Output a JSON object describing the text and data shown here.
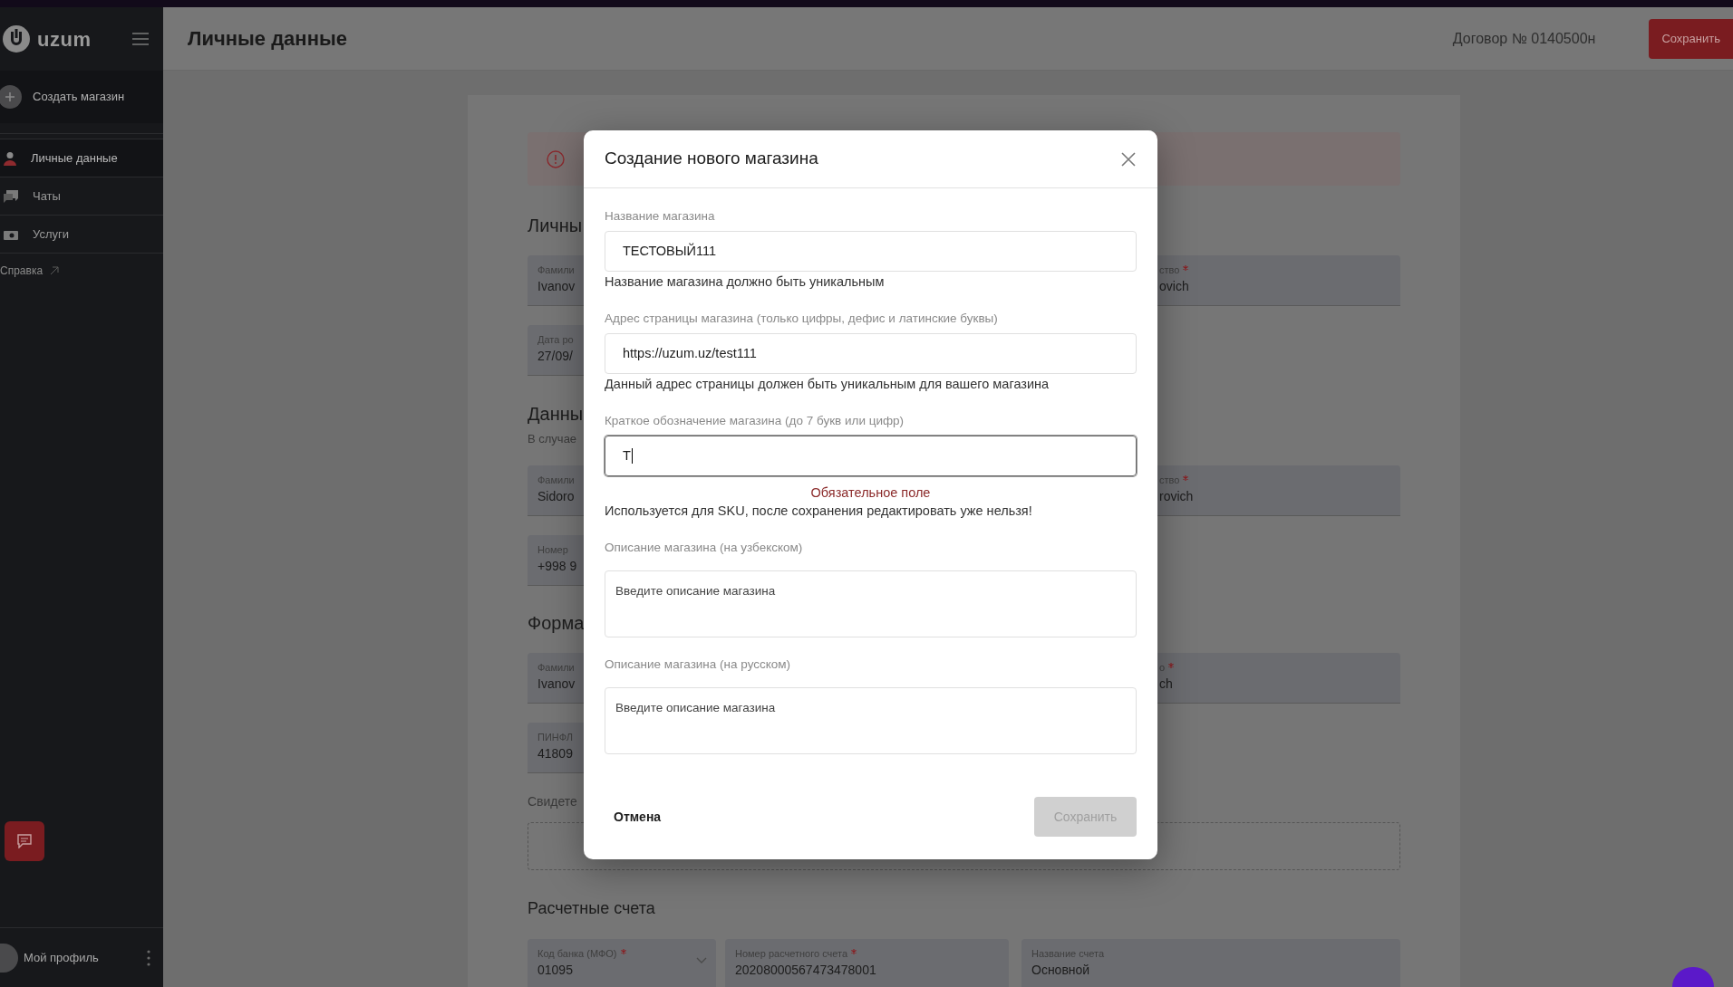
{
  "sidebar": {
    "logo": "uzum",
    "create_button": "Создать магазин",
    "items": [
      {
        "label": "Личные данные",
        "selected": true
      },
      {
        "label": "Чаты",
        "selected": false
      },
      {
        "label": "Услуги",
        "selected": false
      }
    ],
    "help_link": "Справка",
    "profile": "Мой профиль"
  },
  "header": {
    "title": "Личные данные",
    "contract": "Договор № 0140500н",
    "save_button": "Сохранить"
  },
  "page": {
    "sections": [
      {
        "title": "Личны",
        "rows": [
          {
            "left": {
              "label": "Фамили",
              "value": "Ivanov"
            },
            "right": {
              "label": "ство",
              "required": true,
              "value": "ovich"
            }
          },
          {
            "left": {
              "label": "Дата ро",
              "value": "27/09/"
            }
          }
        ]
      },
      {
        "title": "Данны",
        "subtitle": "В случае",
        "rows": [
          {
            "left": {
              "label": "Фамили",
              "value": "Sidoro"
            },
            "right": {
              "label": "ство",
              "required": true,
              "value": "rovich"
            }
          },
          {
            "left": {
              "label": "Номер",
              "value": "+998 9"
            }
          }
        ]
      },
      {
        "title": "Форма",
        "rows": [
          {
            "left": {
              "label": "Фамили",
              "value": "Ivanov"
            },
            "right": {
              "label": "о",
              "required": true,
              "value": "ch"
            }
          },
          {
            "left": {
              "label": "ПИНФЛ",
              "value": "41809"
            }
          }
        ],
        "upload_label": "Свидете"
      }
    ],
    "accounts": {
      "title": "Расчетные счета",
      "fields": [
        {
          "kind": "select",
          "label": "Код банка (МФО)",
          "required": true,
          "value": "01095"
        },
        {
          "kind": "text",
          "label": "Номер расчетного счета",
          "required": true,
          "value": "20208000567473478001"
        },
        {
          "kind": "text",
          "label": "Название счета",
          "required": false,
          "value": "Основной"
        }
      ]
    }
  },
  "modal": {
    "title": "Создание нового магазина",
    "fields": [
      {
        "kind": "input",
        "label": "Название магазина",
        "value": "ТЕСТОВЫЙ111",
        "helper": "Название магазина должно быть уникальным",
        "focused": false
      },
      {
        "kind": "input",
        "label": "Адрес страницы магазина (только цифры, дефис и латинские буквы)",
        "value": "https://uzum.uz/test111",
        "helper": "Данный адрес страницы должен быть уникальным для вашего магазина",
        "focused": false
      },
      {
        "kind": "input",
        "label": "Краткое обозначение магазина (до 7 букв или цифр)",
        "value": "Т",
        "error": "Обязательное поле",
        "helper": "Используется для SKU, после сохранения редактировать уже нельзя!",
        "focused": true
      },
      {
        "kind": "textarea",
        "label": "Описание магазина (на узбекском)",
        "placeholder": "Введите описание магазина"
      },
      {
        "kind": "textarea",
        "label": "Описание магазина (на русском)",
        "placeholder": "Введите описание магазина"
      }
    ],
    "cancel_button": "Отмена",
    "save_button": {
      "label": "Сохранить",
      "disabled": true
    }
  }
}
